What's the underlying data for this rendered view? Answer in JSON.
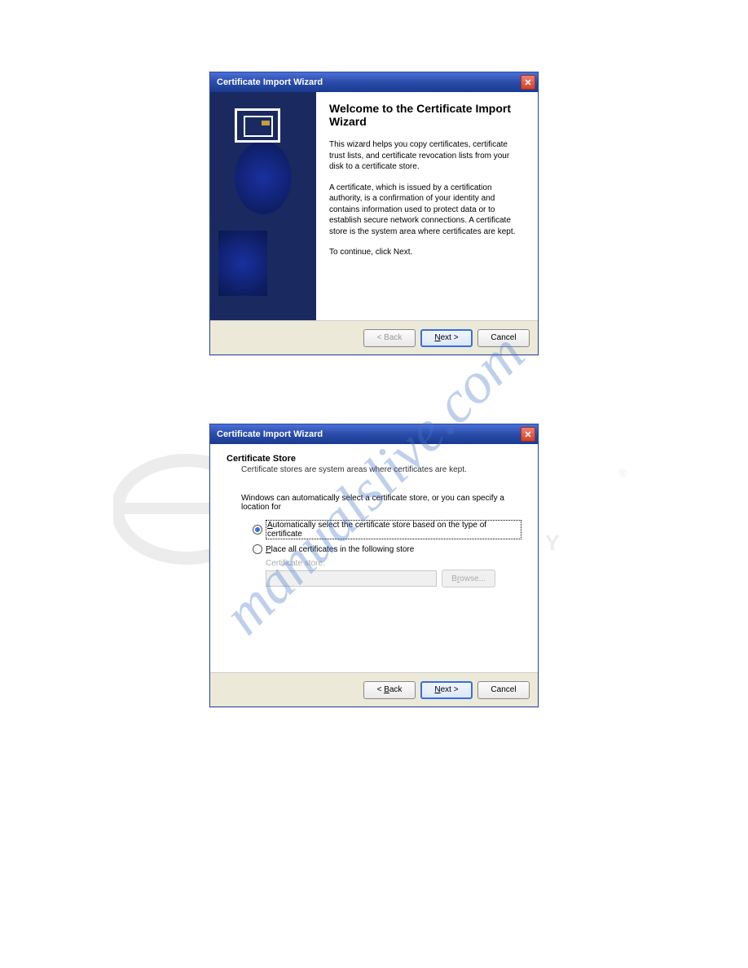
{
  "watermark": "manualslive.com",
  "dialog1": {
    "title": "Certificate Import Wizard",
    "heading": "Welcome to the Certificate Import Wizard",
    "para1": "This wizard helps you copy certificates, certificate trust lists, and certificate revocation lists from your disk to a certificate store.",
    "para2": "A certificate, which is issued by a certification authority, is a confirmation of your identity and contains information used to protect data or to establish secure network connections. A certificate store is the system area where certificates are kept.",
    "para3": "To continue, click Next.",
    "buttons": {
      "back": "< Back",
      "next": "Next >",
      "cancel": "Cancel"
    }
  },
  "dialog2": {
    "title": "Certificate Import Wizard",
    "heading": "Certificate Store",
    "subheading": "Certificate stores are system areas where certificates are kept.",
    "prompt": "Windows can automatically select a certificate store, or you can specify a location for",
    "radio1": "Automatically select the certificate store based on the type of certificate",
    "radio2": "Place all certificates in the following store",
    "store_label": "Certificate store:",
    "browse": "Browse...",
    "buttons": {
      "back": "< Back",
      "next": "Next >",
      "cancel": "Cancel"
    }
  }
}
